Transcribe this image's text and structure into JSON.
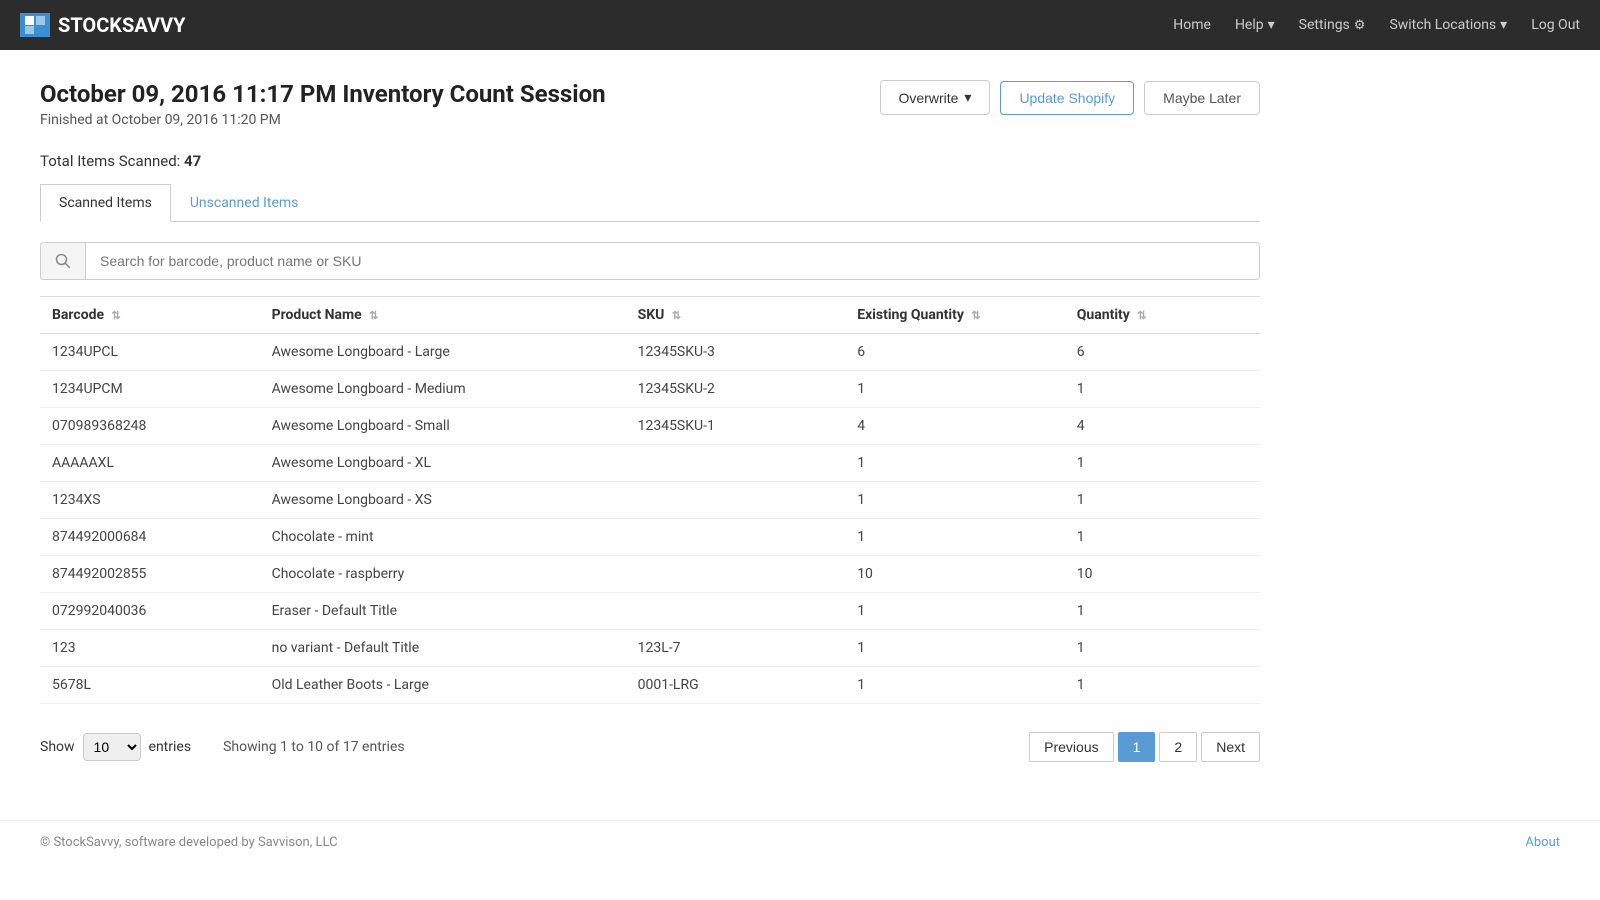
{
  "navbar": {
    "brand": "STOCKSAVVY",
    "nav_items": [
      {
        "label": "Home",
        "has_caret": false
      },
      {
        "label": "Help",
        "has_caret": true
      },
      {
        "label": "Settings",
        "has_caret": false,
        "has_gear": true
      },
      {
        "label": "Switch Locations",
        "has_caret": true
      },
      {
        "label": "Log Out",
        "has_caret": false
      }
    ]
  },
  "page": {
    "title": "October 09, 2016 11:17 PM Inventory Count Session",
    "subtitle": "Finished at October 09, 2016 11:20 PM",
    "total_items_label": "Total Items Scanned:",
    "total_items_count": "47",
    "actions": {
      "overwrite_label": "Overwrite",
      "update_shopify_label": "Update Shopify",
      "maybe_later_label": "Maybe Later"
    }
  },
  "tabs": [
    {
      "label": "Scanned Items",
      "active": true
    },
    {
      "label": "Unscanned Items",
      "active": false
    }
  ],
  "search": {
    "placeholder": "Search for barcode, product name or SKU"
  },
  "table": {
    "columns": [
      {
        "label": "Barcode",
        "sortable": true
      },
      {
        "label": "Product Name",
        "sortable": true
      },
      {
        "label": "SKU",
        "sortable": true
      },
      {
        "label": "Existing Quantity",
        "sortable": true
      },
      {
        "label": "Quantity",
        "sortable": true
      }
    ],
    "rows": [
      {
        "barcode": "1234UPCL",
        "product_name": "Awesome Longboard - Large",
        "sku": "12345SKU-3",
        "existing_qty": "6",
        "quantity": "6"
      },
      {
        "barcode": "1234UPCM",
        "product_name": "Awesome Longboard - Medium",
        "sku": "12345SKU-2",
        "existing_qty": "1",
        "quantity": "1"
      },
      {
        "barcode": "070989368248",
        "product_name": "Awesome Longboard - Small",
        "sku": "12345SKU-1",
        "existing_qty": "4",
        "quantity": "4"
      },
      {
        "barcode": "AAAAAXL",
        "product_name": "Awesome Longboard - XL",
        "sku": "",
        "existing_qty": "1",
        "quantity": "1"
      },
      {
        "barcode": "1234XS",
        "product_name": "Awesome Longboard - XS",
        "sku": "",
        "existing_qty": "1",
        "quantity": "1"
      },
      {
        "barcode": "874492000684",
        "product_name": "Chocolate - mint",
        "sku": "",
        "existing_qty": "1",
        "quantity": "1"
      },
      {
        "barcode": "874492002855",
        "product_name": "Chocolate - raspberry",
        "sku": "",
        "existing_qty": "10",
        "quantity": "10"
      },
      {
        "barcode": "072992040036",
        "product_name": "Eraser - Default Title",
        "sku": "",
        "existing_qty": "1",
        "quantity": "1"
      },
      {
        "barcode": "123",
        "product_name": "no variant - Default Title",
        "sku": "123L-7",
        "existing_qty": "1",
        "quantity": "1"
      },
      {
        "barcode": "5678L",
        "product_name": "Old Leather Boots - Large",
        "sku": "0001-LRG",
        "existing_qty": "1",
        "quantity": "1"
      }
    ]
  },
  "pagination": {
    "show_label": "Show",
    "entries_label": "entries",
    "show_value": "10",
    "showing_text": "Showing 1 to 10 of 17 entries",
    "previous_label": "Previous",
    "next_label": "Next",
    "pages": [
      "1",
      "2"
    ],
    "current_page": "1"
  },
  "footer": {
    "copyright": "© StockSavvy, software developed by Savvison, LLC",
    "about_label": "About"
  }
}
